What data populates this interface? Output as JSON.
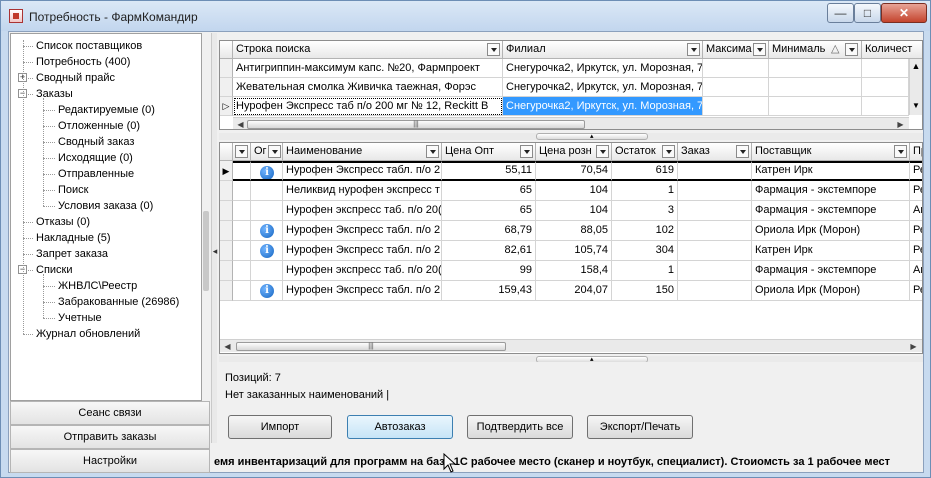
{
  "window": {
    "title": "Потребность - ФармКомандир",
    "controls": {
      "minimize": "—",
      "maximize": "□",
      "close": "✕"
    }
  },
  "tree": [
    {
      "label": "Список поставщиков",
      "level": 0,
      "expander": ""
    },
    {
      "label": "Потребность (400)",
      "level": 0,
      "expander": ""
    },
    {
      "label": "Сводный прайс",
      "level": 0,
      "expander": "+"
    },
    {
      "label": "Заказы",
      "level": 0,
      "expander": "−"
    },
    {
      "label": "Редактируемые (0)",
      "level": 1,
      "expander": ""
    },
    {
      "label": "Отложенные (0)",
      "level": 1,
      "expander": ""
    },
    {
      "label": "Сводный заказ",
      "level": 1,
      "expander": ""
    },
    {
      "label": "Исходящие (0)",
      "level": 1,
      "expander": ""
    },
    {
      "label": "Отправленные",
      "level": 1,
      "expander": ""
    },
    {
      "label": "Поиск",
      "level": 1,
      "expander": ""
    },
    {
      "label": "Условия заказа (0)",
      "level": 1,
      "expander": ""
    },
    {
      "label": "Отказы (0)",
      "level": 0,
      "expander": ""
    },
    {
      "label": "Накладные (5)",
      "level": 0,
      "expander": ""
    },
    {
      "label": "Запрет заказа",
      "level": 0,
      "expander": ""
    },
    {
      "label": "Списки",
      "level": 0,
      "expander": "−"
    },
    {
      "label": "ЖНВЛС\\Реестр",
      "level": 1,
      "expander": ""
    },
    {
      "label": "Забракованные (26986)",
      "level": 1,
      "expander": ""
    },
    {
      "label": "Учетные",
      "level": 1,
      "expander": ""
    },
    {
      "label": "Журнал обновлений",
      "level": 0,
      "expander": ""
    }
  ],
  "nav_buttons": {
    "session": "Сеанс связи",
    "send_orders": "Отправить заказы",
    "settings": "Настройки"
  },
  "search_grid": {
    "columns": [
      "Строка поиска",
      "Филиал",
      "Максима",
      "Минималь",
      "Количест"
    ],
    "sort_indicator": "△",
    "rows": [
      {
        "query": "Антигриппин-максимум капс. №20, Фармпроект",
        "branch": "Снегурочка2, Иркутск, ул. Морозная, 7",
        "current": false
      },
      {
        "query": "Жевательная смолка  Живичка таежная, Форэс",
        "branch": "Снегурочка2, Иркутск, ул. Морозная, 7",
        "current": false
      },
      {
        "query": "Нурофен Экспресс таб п/о 200 мг № 12, Reckitt B",
        "branch": "Снегурочка2, Иркутск, ул. Морозная, 7",
        "current": true
      }
    ]
  },
  "offers_grid": {
    "columns": {
      "c0": "",
      "c1": "Ог",
      "c2": "Наименование",
      "c3": "Цена Опт",
      "c4": "Цена розн",
      "c5": "Остаток",
      "c6": "Заказ",
      "c7": "Поставщик",
      "c8": "Пр"
    },
    "rows": [
      {
        "info": true,
        "name": "Нурофен Экспресс табл. п/о 2",
        "price_opt": "55,11",
        "price_retail": "70,54",
        "stock": "619",
        "order": "",
        "supplier": "Катрен Ирк",
        "extra": "Ре",
        "current": true
      },
      {
        "info": false,
        "name": "Неликвид нурофен экспресс т",
        "price_opt": "65",
        "price_retail": "104",
        "stock": "1",
        "order": "",
        "supplier": "Фармация - экстемпоре",
        "extra": "Ре",
        "current": false
      },
      {
        "info": false,
        "name": "Нурофен экспресс таб. п/о 20(",
        "price_opt": "65",
        "price_retail": "104",
        "stock": "3",
        "order": "",
        "supplier": "Фармация - экстемпоре",
        "extra": "Ап",
        "current": false
      },
      {
        "info": true,
        "name": "Нурофен Экспресс табл. п/о 2",
        "price_opt": "68,79",
        "price_retail": "88,05",
        "stock": "102",
        "order": "",
        "supplier": "Ориола Ирк (Морон)",
        "extra": "Ре",
        "current": false
      },
      {
        "info": true,
        "name": "Нурофен Экспресс табл. п/о 2",
        "price_opt": "82,61",
        "price_retail": "105,74",
        "stock": "304",
        "order": "",
        "supplier": "Катрен Ирк",
        "extra": "Ре",
        "current": false
      },
      {
        "info": false,
        "name": "Нурофен экспресс таб. п/о 20(",
        "price_opt": "99",
        "price_retail": "158,4",
        "stock": "1",
        "order": "",
        "supplier": "Фармация - экстемпоре",
        "extra": "Ап",
        "current": false
      },
      {
        "info": true,
        "name": "Нурофен Экспресс табл. п/о 2",
        "price_opt": "159,43",
        "price_retail": "204,07",
        "stock": "150",
        "order": "",
        "supplier": "Ориола Ирк (Морон)",
        "extra": "Ре",
        "current": false
      }
    ]
  },
  "status": {
    "positions": "Позиций: 7",
    "no_orders": "Нет заказанных наименований |"
  },
  "buttons": {
    "import": "Импорт",
    "autoorder": "Автозаказ",
    "confirm_all": "Подтвердить все",
    "export_print": "Экспорт/Печать"
  },
  "ticker": "емя инвентаризаций для программ на базе 1С рабочее место (сканер и ноутбук, специалист). Стоиомсть за 1 рабочее мест",
  "colors": {
    "selection": "#3399ff",
    "info_icon": "#1565c0",
    "frame": "#c7daef"
  }
}
